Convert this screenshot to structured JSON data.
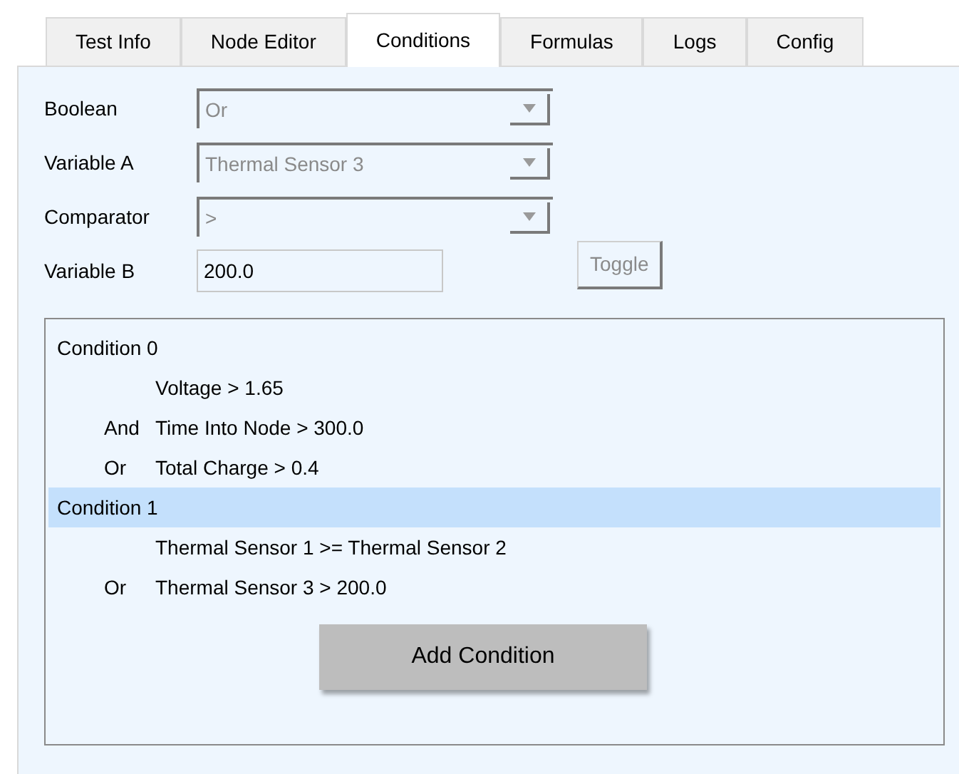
{
  "tabs": [
    {
      "label": "Test Info",
      "selected": false
    },
    {
      "label": "Node Editor",
      "selected": false
    },
    {
      "label": "Conditions",
      "selected": true
    },
    {
      "label": "Formulas",
      "selected": false
    },
    {
      "label": "Logs",
      "selected": false
    },
    {
      "label": "Config",
      "selected": false
    }
  ],
  "form": [
    {
      "kind": "dropdown",
      "label": "Boolean",
      "value": "Or",
      "disabled": true
    },
    {
      "kind": "dropdown",
      "label": "Variable A",
      "value": "Thermal Sensor 3",
      "disabled": true
    },
    {
      "kind": "dropdown",
      "label": "Comparator",
      "value": ">",
      "disabled": true
    },
    {
      "kind": "field",
      "label": "Variable B",
      "value": "200.0",
      "disabled": false
    }
  ],
  "toggle_button": {
    "label": "Toggle",
    "disabled": true
  },
  "conditions": [
    {
      "label": "Condition 0",
      "selected": false,
      "children": [
        {
          "text": "Voltage > 1.65"
        },
        {
          "op": "And",
          "text": "Time Into Node > 300.0"
        },
        {
          "op": "Or",
          "text": "Total Charge > 0.4"
        }
      ]
    },
    {
      "label": "Condition 1",
      "selected": true,
      "children": [
        {
          "text": "Thermal Sensor 1 >= Thermal Sensor 2"
        },
        {
          "op": "Or",
          "text": "Thermal Sensor 3 > 200.0"
        }
      ]
    }
  ],
  "add_button": {
    "label": "Add Condition"
  }
}
